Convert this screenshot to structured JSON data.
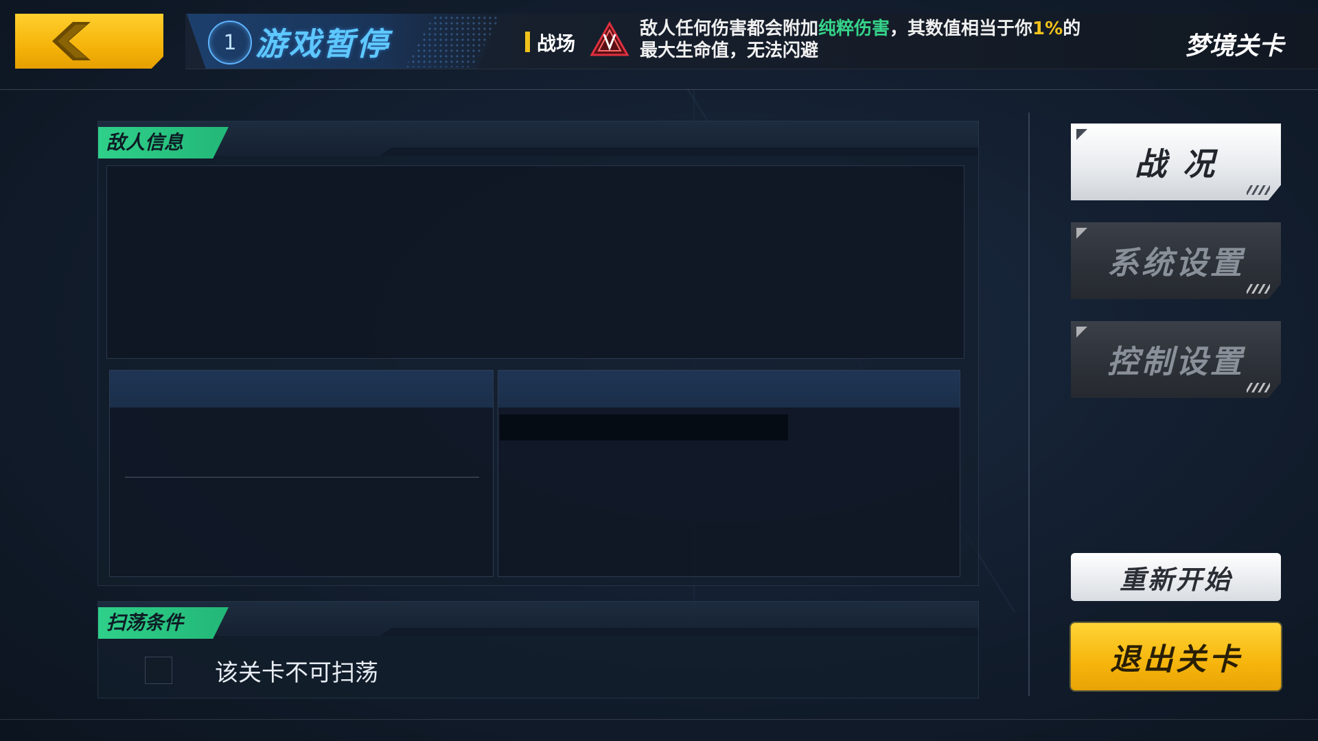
{
  "header": {
    "stage_number": "1",
    "title": "游戏暂停",
    "battlefield_label": "战场",
    "modifier": {
      "part1": "敌人任何伤害都会附加",
      "highlight": "纯粹伤害",
      "part2": "，其数值相当于你",
      "value": "1%",
      "part3": "的最大生命值，无法闪避"
    },
    "mode_label": "梦境关卡"
  },
  "enemy_panel": {
    "tag": "敌人信息"
  },
  "sweep_panel": {
    "tag": "扫荡条件",
    "text": "该关卡不可扫荡"
  },
  "side_menu": {
    "battle_status": "战 况",
    "system_settings": "系统设置",
    "control_settings": "控制设置",
    "restart": "重新开始",
    "exit_stage": "退出关卡"
  },
  "colors": {
    "accent_yellow": "#f2c21b",
    "accent_green": "#35d48a",
    "title_blue": "#5ec8ff"
  },
  "icons": [
    "back-chevron-icon",
    "stage-number-icon",
    "battlefield-emblem-icon"
  ]
}
